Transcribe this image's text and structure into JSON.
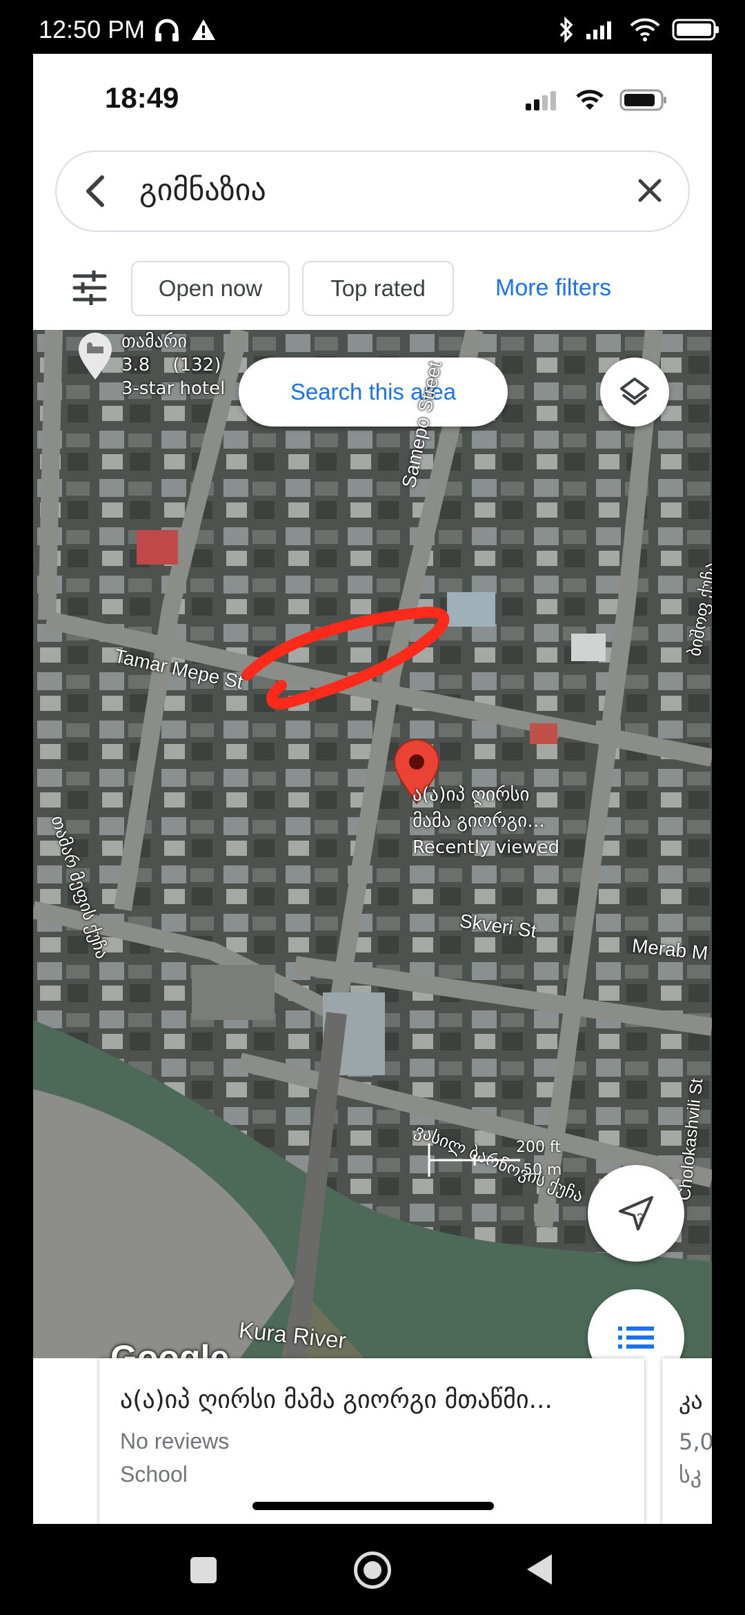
{
  "android_status": {
    "time": "12:50 PM"
  },
  "ios_status": {
    "time": "18:49"
  },
  "search": {
    "query": "გიმნაზია"
  },
  "filters": {
    "open_now": "Open now",
    "top_rated": "Top rated",
    "more_filters": "More filters"
  },
  "map": {
    "search_this_area": "Search this area",
    "hotel": {
      "name": "თამარი",
      "rating": "3.8",
      "reviews": "(132)",
      "type": "3-star hotel"
    },
    "streets": {
      "samepo": "Samepo Street",
      "tamar_mepe": "Tamar Mepe St",
      "skveri": "Skveri St",
      "merab": "Merab M",
      "cholokashvili": "Cholokashvili St",
      "river": "Kura River",
      "left_vertical": "თამარ მეფის ქუჩა",
      "right_vertical": "ბიშოფ ქუჩა",
      "bottom_street": "ვასილ ბარნოვის ქუჩა"
    },
    "place": {
      "line1": "ა(ა)იპ ღირსი",
      "line2": "მამა გიორგი...",
      "line3": "Recently viewed"
    },
    "scale": {
      "ft": "200 ft",
      "m": "50 m"
    },
    "attribution": "Google"
  },
  "card": {
    "title": "ა(ა)იპ ღირსი მამა გიორგი მთაწმი...",
    "reviews": "No reviews",
    "type": "School"
  },
  "card_next": {
    "t1": "კა",
    "t2": "5,0",
    "t3": "სკ"
  },
  "colors": {
    "accent": "#1a73e8",
    "pin": "#ea4335",
    "annotation": "#ff2a1a"
  }
}
